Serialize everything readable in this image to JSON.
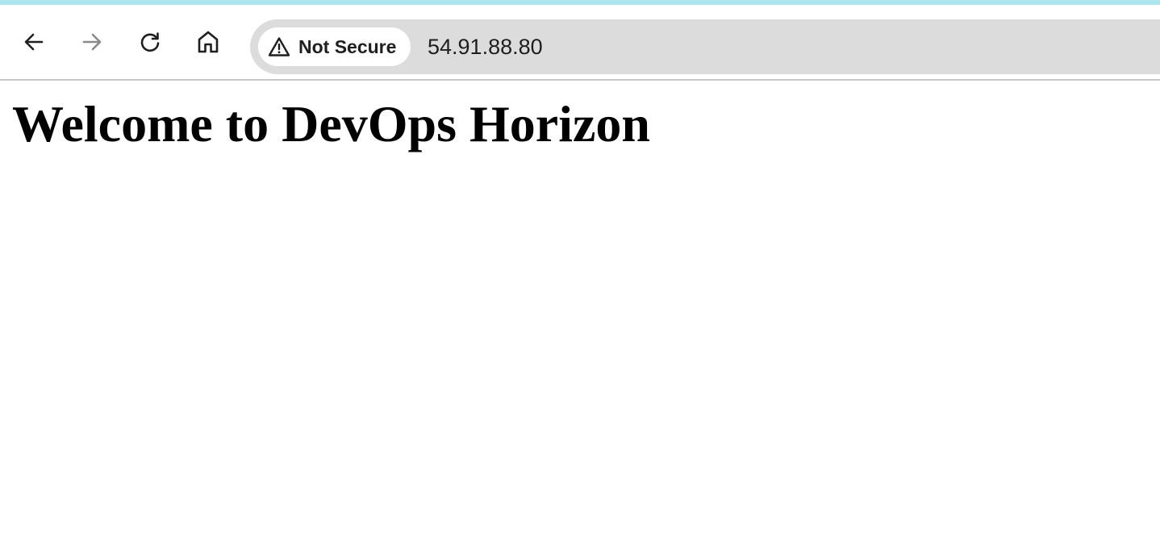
{
  "browser": {
    "nav": {
      "back_icon": "arrow-left-icon",
      "forward_icon": "arrow-right-icon",
      "forward_enabled": false,
      "reload_icon": "reload-icon",
      "home_icon": "home-icon"
    },
    "address_bar": {
      "security_label": "Not Secure",
      "security_icon": "warning-triangle-icon",
      "url": "54.91.88.80"
    },
    "colors": {
      "top_strip": "#aee6ee",
      "omnibox_bg": "#dcdcdc",
      "chip_bg": "#ffffff",
      "disabled_icon": "#8a8a8a"
    }
  },
  "page": {
    "heading": "Welcome to DevOps Horizon"
  }
}
